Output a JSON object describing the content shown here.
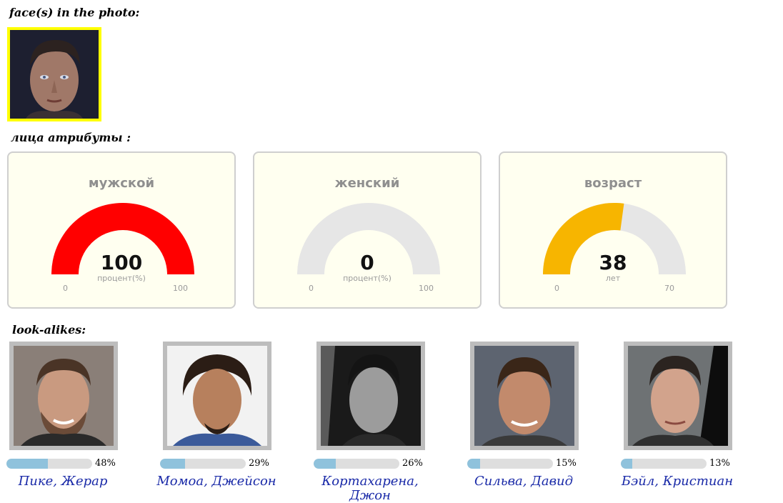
{
  "sections": {
    "faces_title": "face(s) in the photo:",
    "attributes_title": "лица атрибуты :",
    "lookalikes_title": "look-alikes:"
  },
  "gauges": [
    {
      "title": "мужской",
      "value": "100",
      "unit": "процент(%)",
      "min": "0",
      "max": "100",
      "fraction": 1.0,
      "color": "#ff0000"
    },
    {
      "title": "женский",
      "value": "0",
      "unit": "процент(%)",
      "min": "0",
      "max": "100",
      "fraction": 0.0,
      "color": "#e6e6e6"
    },
    {
      "title": "возраст",
      "value": "38",
      "unit": "лет",
      "min": "0",
      "max": "70",
      "fraction": 0.5429,
      "color": "#f7b500"
    }
  ],
  "lookalikes": [
    {
      "name": "Пике, Жерар",
      "percent": "48%",
      "fraction": 0.48
    },
    {
      "name": "Момоа, Джейсон",
      "percent": "29%",
      "fraction": 0.29
    },
    {
      "name": "Кортахарена, Джон",
      "percent": "26%",
      "fraction": 0.26
    },
    {
      "name": "Сильва, Давид",
      "percent": "15%",
      "fraction": 0.15
    },
    {
      "name": "Бэйл, Кристиан",
      "percent": "13%",
      "fraction": 0.13
    }
  ],
  "colors": {
    "gauge_track": "#e6e6e6",
    "bar_fill": "#8fc2dc",
    "bar_track": "#dedede",
    "link": "#1a2aa8",
    "highlight": "#ffff00"
  }
}
